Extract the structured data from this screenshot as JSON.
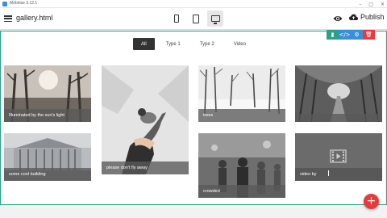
{
  "window": {
    "title": "Mobirise 3.12.1",
    "controls": [
      "minimize-icon",
      "maximize-icon",
      "close-icon"
    ]
  },
  "toolbar": {
    "filename": "gallery.html",
    "devices": [
      "phone-icon",
      "tablet-icon",
      "desktop-icon"
    ],
    "active_device": "desktop",
    "publish_label": "Publish"
  },
  "block_actions": [
    {
      "icon": "phone-icon",
      "color": "#2aa08a"
    },
    {
      "icon": "code-icon",
      "color": "#3a8fd6"
    },
    {
      "icon": "gear-icon",
      "color": "#3a8fd6"
    },
    {
      "icon": "trash-icon",
      "color": "#e8393b"
    }
  ],
  "gallery": {
    "filters": [
      "All",
      "Type 1",
      "Type 2",
      "Video"
    ],
    "active_filter": "All",
    "items": [
      {
        "caption": "Illuminated by the sun's light"
      },
      {
        "caption": "please don't fly away"
      },
      {
        "caption": "trees"
      },
      {
        "caption": ""
      },
      {
        "caption": "some cool building"
      },
      {
        "caption": "crowded"
      },
      {
        "caption": "video by"
      }
    ]
  },
  "colors": {
    "canvas_border": "#2aa08a",
    "fab": "#e8393b",
    "filter_active": "#333333"
  },
  "fab_label": "+"
}
